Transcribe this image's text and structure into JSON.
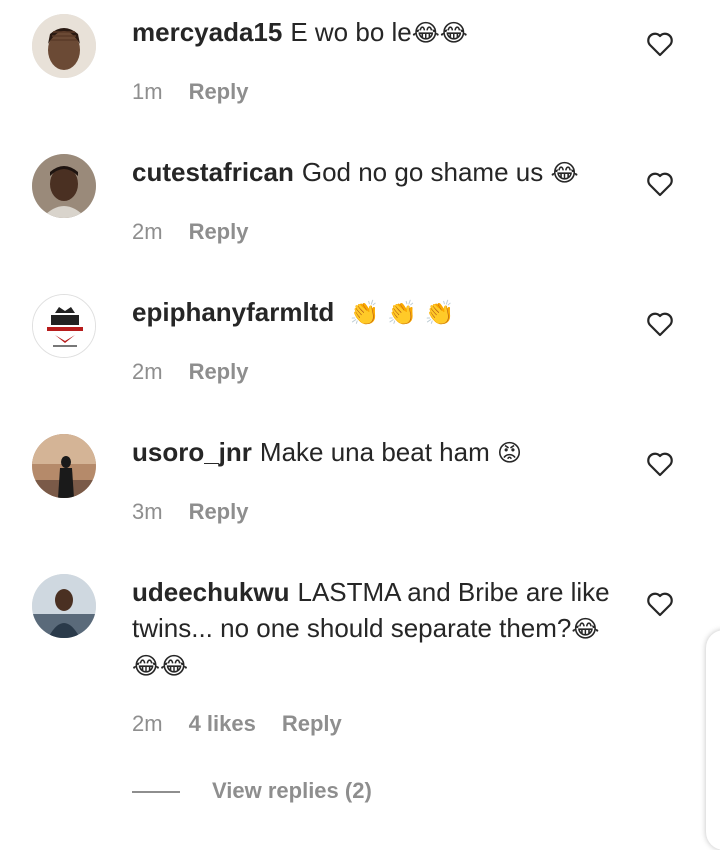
{
  "comments": [
    {
      "username": "mercyada15",
      "text": "E wo bo le",
      "emoji": "😂😂",
      "time": "1m",
      "likes": "",
      "reply": "Reply"
    },
    {
      "username": "cutestafrican",
      "text": "God no go shame us",
      "emoji": "😂",
      "time": "2m",
      "likes": "",
      "reply": "Reply"
    },
    {
      "username": "epiphanyfarmltd",
      "text": "",
      "emoji": "👏 👏 👏",
      "time": "2m",
      "likes": "",
      "reply": "Reply"
    },
    {
      "username": "usoro_jnr",
      "text": "Make una beat ham",
      "emoji": "😡",
      "time": "3m",
      "likes": "",
      "reply": "Reply"
    },
    {
      "username": "udeechukwu",
      "text": "LASTMA and Bribe are like twins... no one should separate them?",
      "emoji": "😂😂😂",
      "time": "2m",
      "likes": "4 likes",
      "reply": "Reply"
    }
  ],
  "view_replies": "View replies (2)",
  "icons": {
    "like": "heart-outline-icon"
  },
  "colors": {
    "text": "#262626",
    "muted": "#8e8e8e"
  }
}
